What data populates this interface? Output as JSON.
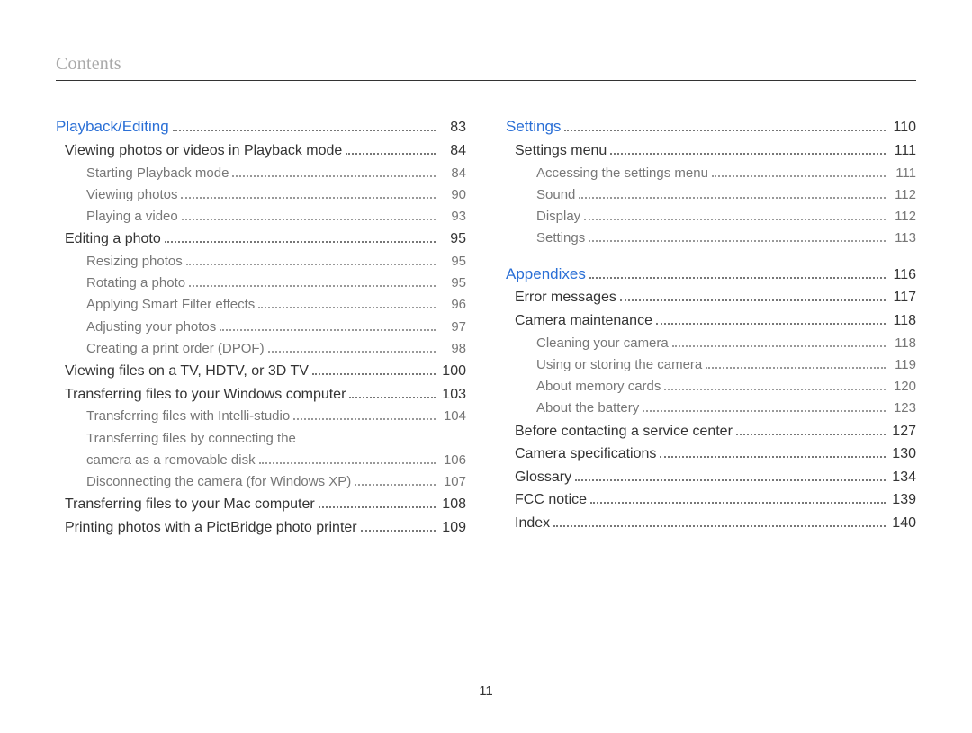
{
  "header": {
    "title": "Contents"
  },
  "footer": {
    "page_number": "11"
  },
  "columns": [
    [
      {
        "level": "section",
        "title": "Playback/Editing",
        "page": "83"
      },
      {
        "level": 1,
        "title": "Viewing photos or videos in Playback mode",
        "page": "84"
      },
      {
        "level": 2,
        "title": "Starting Playback mode",
        "page": "84"
      },
      {
        "level": 2,
        "title": "Viewing photos",
        "page": "90"
      },
      {
        "level": 2,
        "title": "Playing a video",
        "page": "93"
      },
      {
        "level": 1,
        "title": "Editing a photo",
        "page": "95"
      },
      {
        "level": 2,
        "title": "Resizing photos",
        "page": "95"
      },
      {
        "level": 2,
        "title": "Rotating a photo",
        "page": "95"
      },
      {
        "level": 2,
        "title": "Applying Smart Filter effects",
        "page": "96"
      },
      {
        "level": 2,
        "title": "Adjusting your photos",
        "page": "97"
      },
      {
        "level": 2,
        "title": "Creating a print order (DPOF)",
        "page": "98"
      },
      {
        "level": 1,
        "title": "Viewing files on a TV, HDTV, or 3D TV",
        "page": "100"
      },
      {
        "level": 1,
        "title": "Transferring files to your Windows computer",
        "page": "103"
      },
      {
        "level": 2,
        "title": "Transferring files with Intelli-studio",
        "page": "104"
      },
      {
        "level": 2,
        "title": "Transferring files by connecting the",
        "no_dots": true,
        "no_page": true
      },
      {
        "level": 2,
        "title": "camera as a removable disk",
        "page": "106"
      },
      {
        "level": 2,
        "title": "Disconnecting the camera (for Windows XP)",
        "page": "107"
      },
      {
        "level": 1,
        "title": "Transferring files to your Mac computer",
        "page": "108"
      },
      {
        "level": 1,
        "title": "Printing photos with a PictBridge photo printer",
        "page": "109"
      }
    ],
    [
      {
        "level": "section",
        "title": "Settings",
        "page": "110"
      },
      {
        "level": 1,
        "title": "Settings menu",
        "page": "111"
      },
      {
        "level": 2,
        "title": "Accessing the settings menu",
        "page": "111"
      },
      {
        "level": 2,
        "title": "Sound",
        "page": "112"
      },
      {
        "level": 2,
        "title": "Display",
        "page": "112"
      },
      {
        "level": 2,
        "title": "Settings",
        "page": "113"
      },
      {
        "level": "section",
        "title": "Appendixes",
        "page": "116",
        "gap_before": true
      },
      {
        "level": 1,
        "title": "Error messages",
        "page": "117"
      },
      {
        "level": 1,
        "title": "Camera maintenance",
        "page": "118"
      },
      {
        "level": 2,
        "title": "Cleaning your camera",
        "page": "118"
      },
      {
        "level": 2,
        "title": "Using or storing the camera",
        "page": "119"
      },
      {
        "level": 2,
        "title": "About memory cards",
        "page": "120"
      },
      {
        "level": 2,
        "title": "About the battery",
        "page": "123"
      },
      {
        "level": 1,
        "title": "Before contacting a service center",
        "page": "127"
      },
      {
        "level": 1,
        "title": "Camera specifications",
        "page": "130"
      },
      {
        "level": 1,
        "title": "Glossary",
        "page": "134"
      },
      {
        "level": 1,
        "title": "FCC notice",
        "page": "139"
      },
      {
        "level": 1,
        "title": "Index",
        "page": "140"
      }
    ]
  ]
}
